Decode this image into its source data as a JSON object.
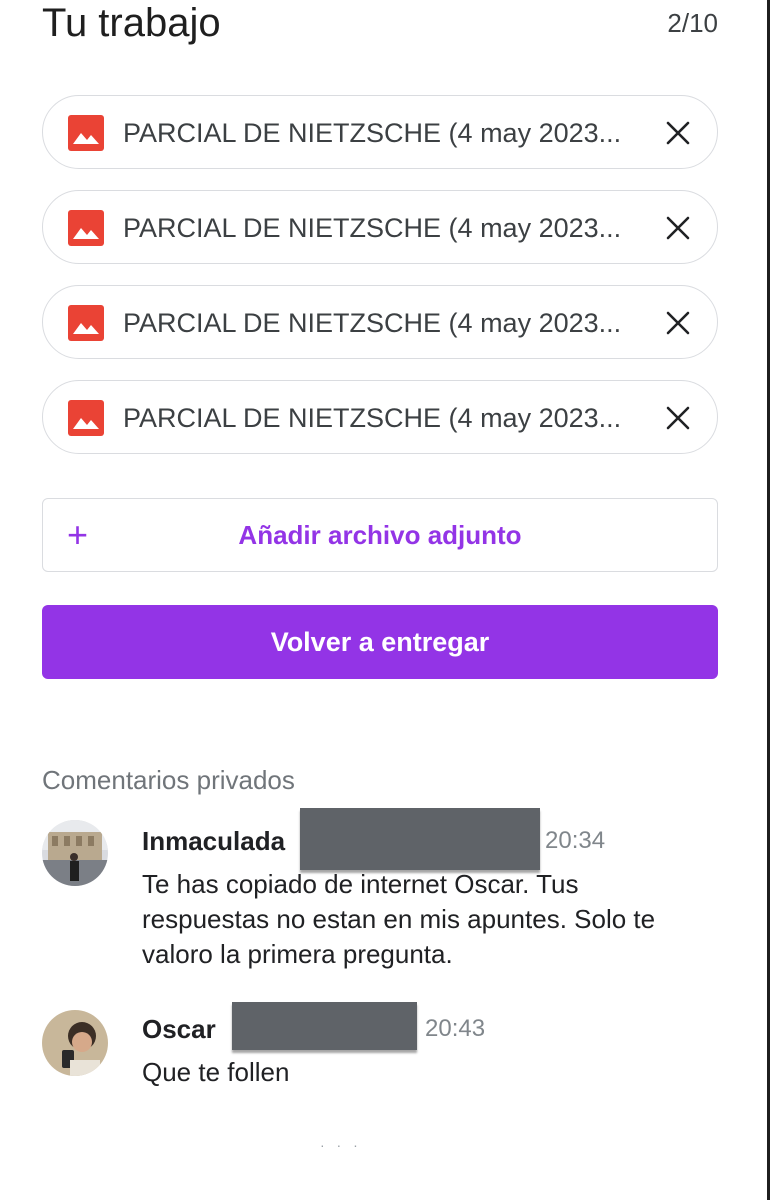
{
  "header": {
    "title": "Tu trabajo",
    "grade": "2/10"
  },
  "attachments": [
    {
      "name": "PARCIAL DE NIETZSCHE (4 may 2023...",
      "icon": "image-file-icon",
      "remove_icon": "close-icon"
    },
    {
      "name": "PARCIAL DE NIETZSCHE (4 may 2023...",
      "icon": "image-file-icon",
      "remove_icon": "close-icon"
    },
    {
      "name": "PARCIAL DE NIETZSCHE (4 may 2023...",
      "icon": "image-file-icon",
      "remove_icon": "close-icon"
    },
    {
      "name": "PARCIAL DE NIETZSCHE (4 may 2023...",
      "icon": "image-file-icon",
      "remove_icon": "close-icon"
    }
  ],
  "add_attachment": {
    "icon": "plus-icon",
    "label": "Añadir archivo adjunto"
  },
  "submit": {
    "label": "Volver a entregar"
  },
  "comments": {
    "title": "Comentarios privados",
    "items": [
      {
        "author": "Inmaculada",
        "time": "20:34",
        "text": "Te has copiado de internet Oscar. Tus respuestas no estan en mis apuntes. Solo te valoro la primera pregunta."
      },
      {
        "author": "Oscar",
        "time": "20:43",
        "text": "Que te follen"
      }
    ]
  },
  "colors": {
    "accent": "#9334e6",
    "image_icon": "#ea4335",
    "border": "#dadce0",
    "redaction": "#5f6368"
  }
}
